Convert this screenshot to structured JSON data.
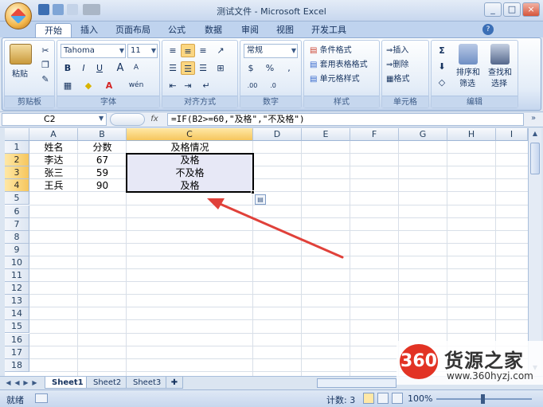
{
  "window": {
    "title": "测试文件 - Microsoft Excel",
    "controls": [
      "_",
      "□",
      "×"
    ]
  },
  "ribbon": {
    "tabs": [
      "开始",
      "插入",
      "页面布局",
      "公式",
      "数据",
      "审阅",
      "视图",
      "开发工具"
    ],
    "active_tab": "开始",
    "clipboard": {
      "paste": "粘贴",
      "group": "剪贴板"
    },
    "font": {
      "name": "Tahoma",
      "size": "11",
      "bold": "B",
      "italic": "I",
      "underline": "U",
      "grow": "A",
      "shrink": "A",
      "font_color": "A",
      "phonetic": "wén",
      "group": "字体"
    },
    "alignment": {
      "group": "对齐方式"
    },
    "number": {
      "format": "常规",
      "percent": "%",
      "comma": ",",
      "currency": "$",
      "inc": ".00",
      "dec": ".0",
      "group": "数字"
    },
    "styles": {
      "conditional": "条件格式",
      "table": "套用表格格式",
      "cell": "单元格样式",
      "group": "样式"
    },
    "cells": {
      "insert": "插入",
      "delete": "删除",
      "format": "格式",
      "group": "单元格"
    },
    "editing": {
      "sigma": "Σ",
      "sort": "排序和",
      "sort2": "筛选",
      "find": "查找和",
      "find2": "选择",
      "group": "编辑"
    }
  },
  "formula_bar": {
    "name_box": "C2",
    "fx": "fx",
    "formula": "=IF(B2>=60,\"及格\",\"不及格\")"
  },
  "sheet": {
    "columns": [
      "A",
      "B",
      "C",
      "D",
      "E",
      "F",
      "G",
      "H",
      "I"
    ],
    "rows": [
      "1",
      "2",
      "3",
      "4",
      "5",
      "6",
      "7",
      "8",
      "9",
      "10",
      "11",
      "12",
      "13",
      "14",
      "15",
      "16",
      "17",
      "18"
    ],
    "cells": [
      [
        "姓名",
        "分数",
        "及格情况"
      ],
      [
        "李达",
        "67",
        "及格"
      ],
      [
        "张三",
        "59",
        "不及格"
      ],
      [
        "王兵",
        "90",
        "及格"
      ]
    ],
    "selected_column": "C",
    "selected_rows": [
      "2",
      "3",
      "4"
    ]
  },
  "sheet_tabs": [
    "Sheet1",
    "Sheet2",
    "Sheet3"
  ],
  "active_sheet": "Sheet1",
  "status": {
    "mode": "就绪",
    "count": "计数: 3",
    "zoom": "100%"
  },
  "watermark": {
    "logo": "360",
    "name": "货源之家",
    "url": "www.360hyzj.com"
  },
  "colors": {
    "arrow": "#e0413a",
    "selection": "#e7e8f6"
  }
}
